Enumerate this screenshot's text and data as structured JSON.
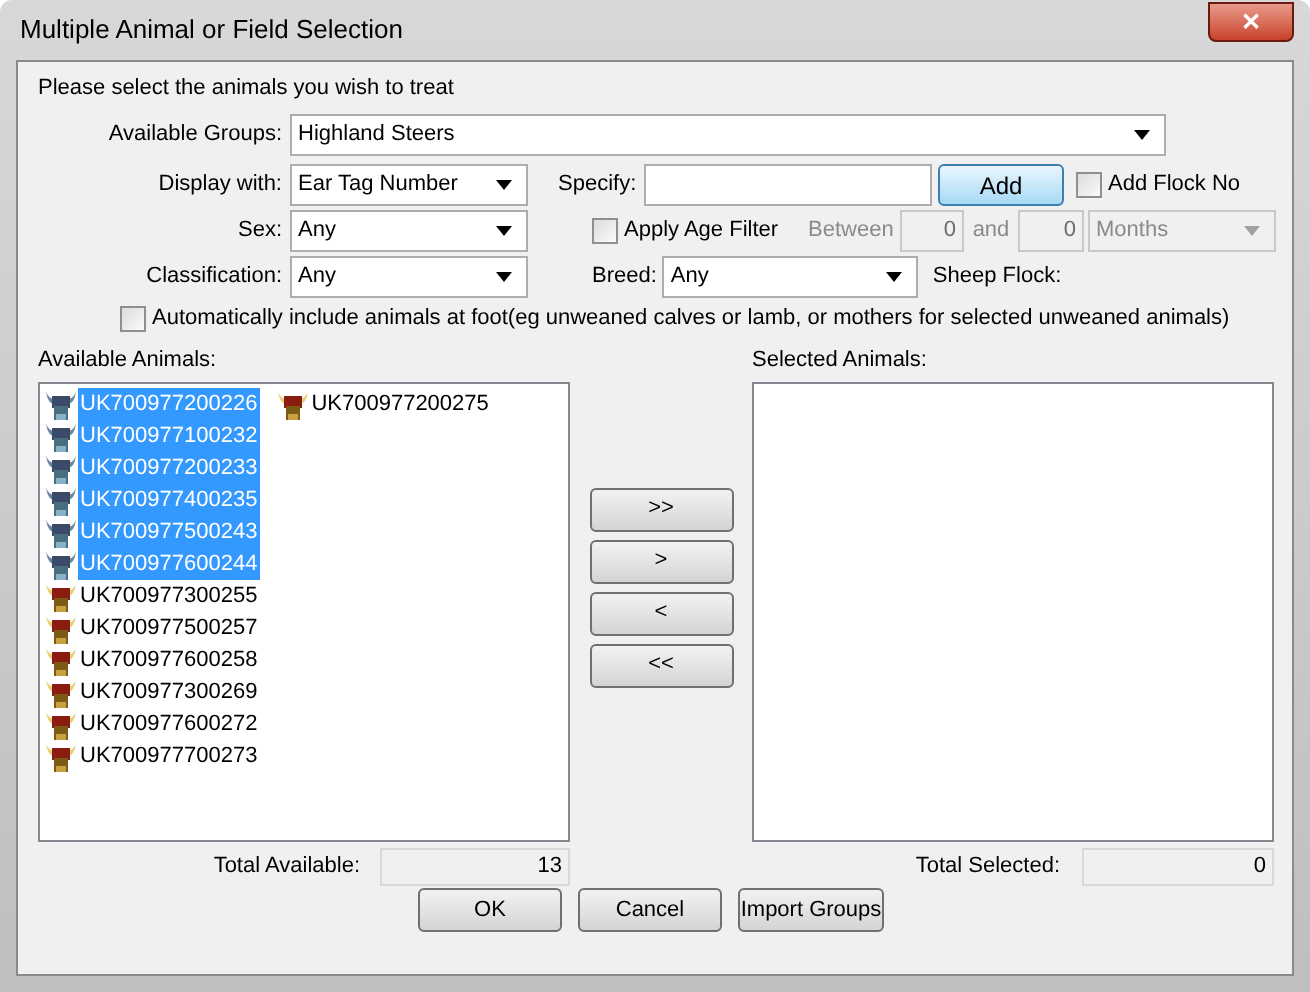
{
  "window": {
    "title": "Multiple Animal or Field Selection",
    "close": "✕"
  },
  "instruction": "Please select the animals you wish to treat",
  "available_groups": {
    "label": "Available Groups:",
    "value": "Highland Steers"
  },
  "display_with": {
    "label": "Display with:",
    "value": "Ear Tag Number"
  },
  "specify": {
    "label": "Specify:"
  },
  "add_button": "Add",
  "add_flock_no": {
    "label": "Add Flock No",
    "checked": false
  },
  "sex": {
    "label": "Sex:",
    "value": "Any"
  },
  "apply_age_filter": {
    "label": "Apply Age Filter",
    "checked": false
  },
  "between": {
    "label": "Between",
    "from": "0",
    "and_label": "and",
    "to": "0",
    "unit": "Months",
    "disabled": true
  },
  "classification": {
    "label": "Classification:",
    "value": "Any"
  },
  "breed": {
    "label": "Breed:",
    "value": "Any"
  },
  "sheep_flock": {
    "label": "Sheep Flock:"
  },
  "auto_include": {
    "label": "Automatically include animals at foot(eg unweaned calves or lamb, or mothers for selected unweaned animals)",
    "checked": false
  },
  "available_animals": {
    "label": "Available Animals:",
    "items": [
      {
        "tag": "UK700977200226",
        "selected": true
      },
      {
        "tag": "UK700977100232",
        "selected": true
      },
      {
        "tag": "UK700977200233",
        "selected": true
      },
      {
        "tag": "UK700977400235",
        "selected": true
      },
      {
        "tag": "UK700977500243",
        "selected": true
      },
      {
        "tag": "UK700977600244",
        "selected": true
      },
      {
        "tag": "UK700977300255",
        "selected": false
      },
      {
        "tag": "UK700977500257",
        "selected": false
      },
      {
        "tag": "UK700977600258",
        "selected": false
      },
      {
        "tag": "UK700977300269",
        "selected": false
      },
      {
        "tag": "UK700977600272",
        "selected": false
      },
      {
        "tag": "UK700977700273",
        "selected": false
      },
      {
        "tag": "UK700977200275",
        "selected": false
      }
    ]
  },
  "move_buttons": [
    ">>",
    ">",
    "<",
    "<<"
  ],
  "selected_animals": {
    "label": "Selected Animals:"
  },
  "total_available": {
    "label": "Total Available:",
    "value": "13"
  },
  "total_selected": {
    "label": "Total Selected:",
    "value": "0"
  },
  "buttons": [
    "OK",
    "Cancel",
    "Import Groups"
  ]
}
